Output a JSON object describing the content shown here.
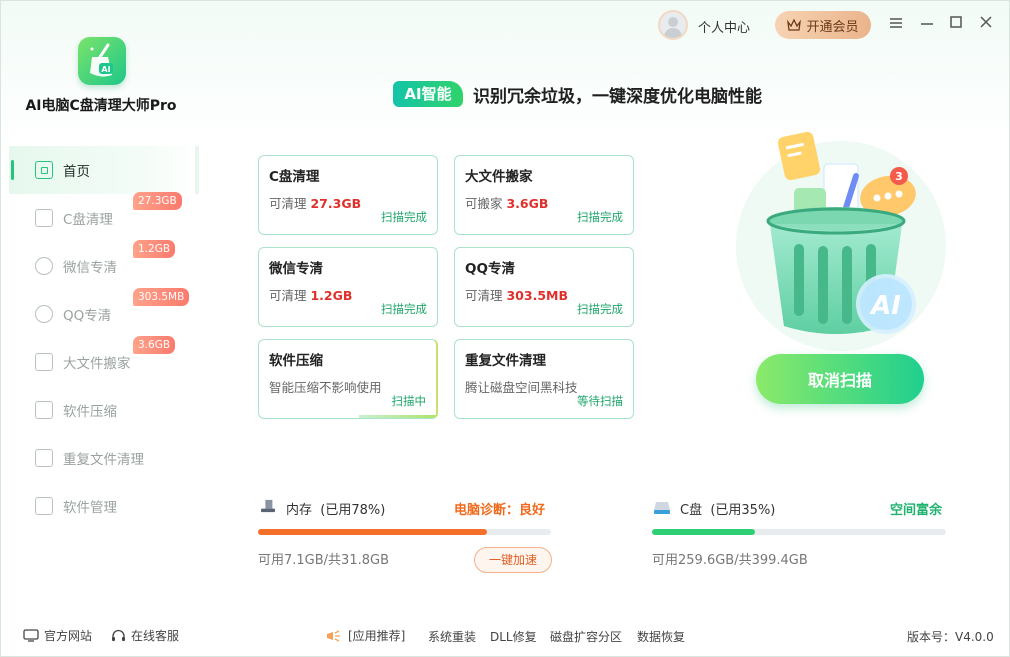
{
  "app": {
    "title": "AI电脑C盘清理大师Pro"
  },
  "titlebar": {
    "user_center": "个人中心",
    "vip_label": "开通会员"
  },
  "sidebar": {
    "items": [
      {
        "label": "首页",
        "badge": "",
        "icon": "home-icon"
      },
      {
        "label": "C盘清理",
        "badge": "27.3GB",
        "icon": "broom-icon"
      },
      {
        "label": "微信专清",
        "badge": "1.2GB",
        "icon": "wechat-icon"
      },
      {
        "label": "QQ专清",
        "badge": "303.5MB",
        "icon": "qq-icon"
      },
      {
        "label": "大文件搬家",
        "badge": "3.6GB",
        "icon": "move-file-icon"
      },
      {
        "label": "软件压缩",
        "badge": "",
        "icon": "compress-icon"
      },
      {
        "label": "重复文件清理",
        "badge": "",
        "icon": "duplicate-file-icon"
      },
      {
        "label": "软件管理",
        "badge": "",
        "icon": "apps-grid-icon"
      }
    ]
  },
  "header": {
    "ai_tag": "AI智能",
    "slogan": "识别冗余垃圾，一键深度优化电脑性能"
  },
  "cards": [
    {
      "title": "C盘清理",
      "prefix": "可清理 ",
      "value": "27.3GB",
      "status": "扫描完成"
    },
    {
      "title": "大文件搬家",
      "prefix": "可搬家 ",
      "value": "3.6GB",
      "status": "扫描完成"
    },
    {
      "title": "微信专清",
      "prefix": "可清理 ",
      "value": "1.2GB",
      "status": "扫描完成"
    },
    {
      "title": "QQ专清",
      "prefix": "可清理 ",
      "value": "303.5MB",
      "status": "扫描完成"
    },
    {
      "title": "软件压缩",
      "prefix": "智能压缩不影响使用",
      "value": "",
      "status": "扫描中"
    },
    {
      "title": "重复文件清理",
      "prefix": "腾让磁盘空间黑科技",
      "value": "",
      "status": "等待扫描"
    }
  ],
  "hero": {
    "badge_count": "3",
    "ai_text": "AI",
    "cancel_label": "取消扫描"
  },
  "memory": {
    "label": "内存",
    "usage": "(已用78%)",
    "used_fraction": 0.78,
    "diagnosis": "电脑诊断：良好",
    "footnote": "可用7.1GB/共31.8GB",
    "speed_label": "一键加速",
    "bar_color": "#f36f2a"
  },
  "disk": {
    "label": "C盘",
    "usage": "(已用35%)",
    "used_fraction": 0.35,
    "status": "空间富余",
    "footnote": "可用259.6GB/共399.4GB",
    "bar_color": "#2fcf74"
  },
  "footer": {
    "website": "官方网站",
    "service": "在线客服",
    "recommend": "[应用推荐]",
    "links": [
      "系统重装",
      "DLL修复",
      "磁盘扩容分区",
      "数据恢复"
    ],
    "version": "版本号：V4.0.0"
  }
}
